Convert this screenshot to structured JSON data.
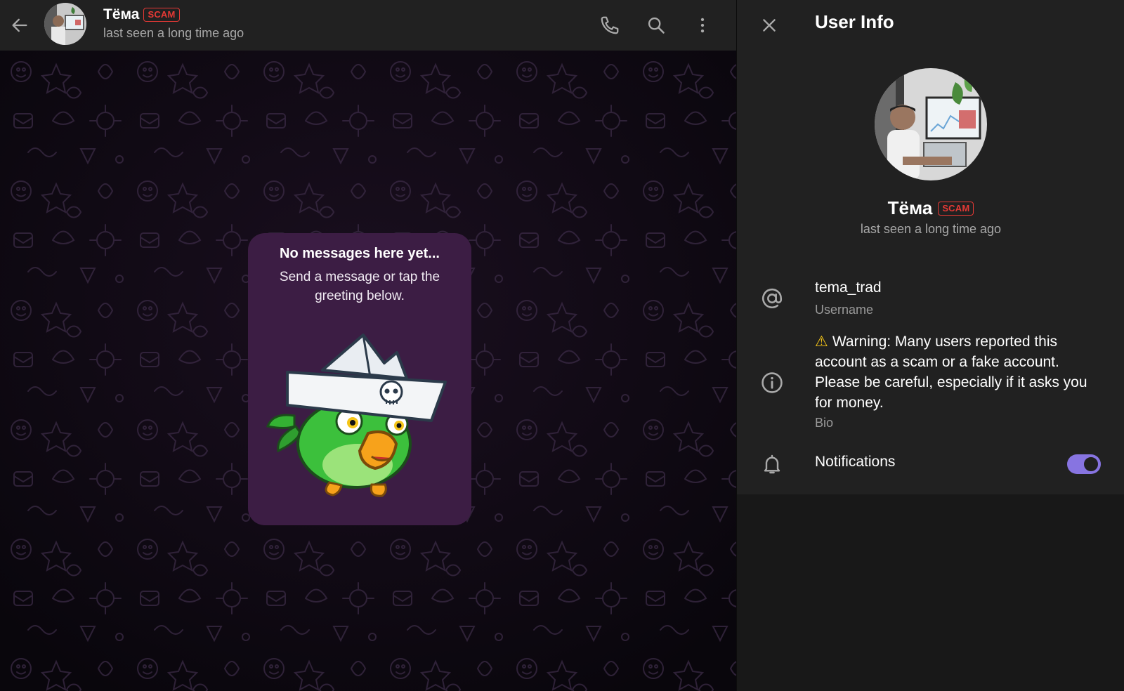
{
  "chat_header": {
    "name": "Тёма",
    "badge": "SCAM",
    "status": "last seen a long time ago",
    "icons": [
      "back-arrow-icon",
      "phone-icon",
      "search-icon",
      "more-vertical-icon"
    ]
  },
  "empty_state": {
    "title": "No messages here yet...",
    "subtitle": "Send a message or tap the greeting below."
  },
  "user_info": {
    "title": "User Info",
    "name": "Тёма",
    "badge": "SCAM",
    "status": "last seen a long time ago",
    "username": "tema_trad",
    "username_label": "Username",
    "bio": "Warning: Many users reported this account as a scam or a fake account. Please be careful, especially if it asks you for money.",
    "bio_label": "Bio",
    "notifications_label": "Notifications",
    "notifications_on": true
  },
  "colors": {
    "accent": "#8774e1",
    "scam_red": "#e53935",
    "warning_yellow": "#f5c518",
    "header_bg": "#212121",
    "card_bg": "#3c1d44"
  }
}
